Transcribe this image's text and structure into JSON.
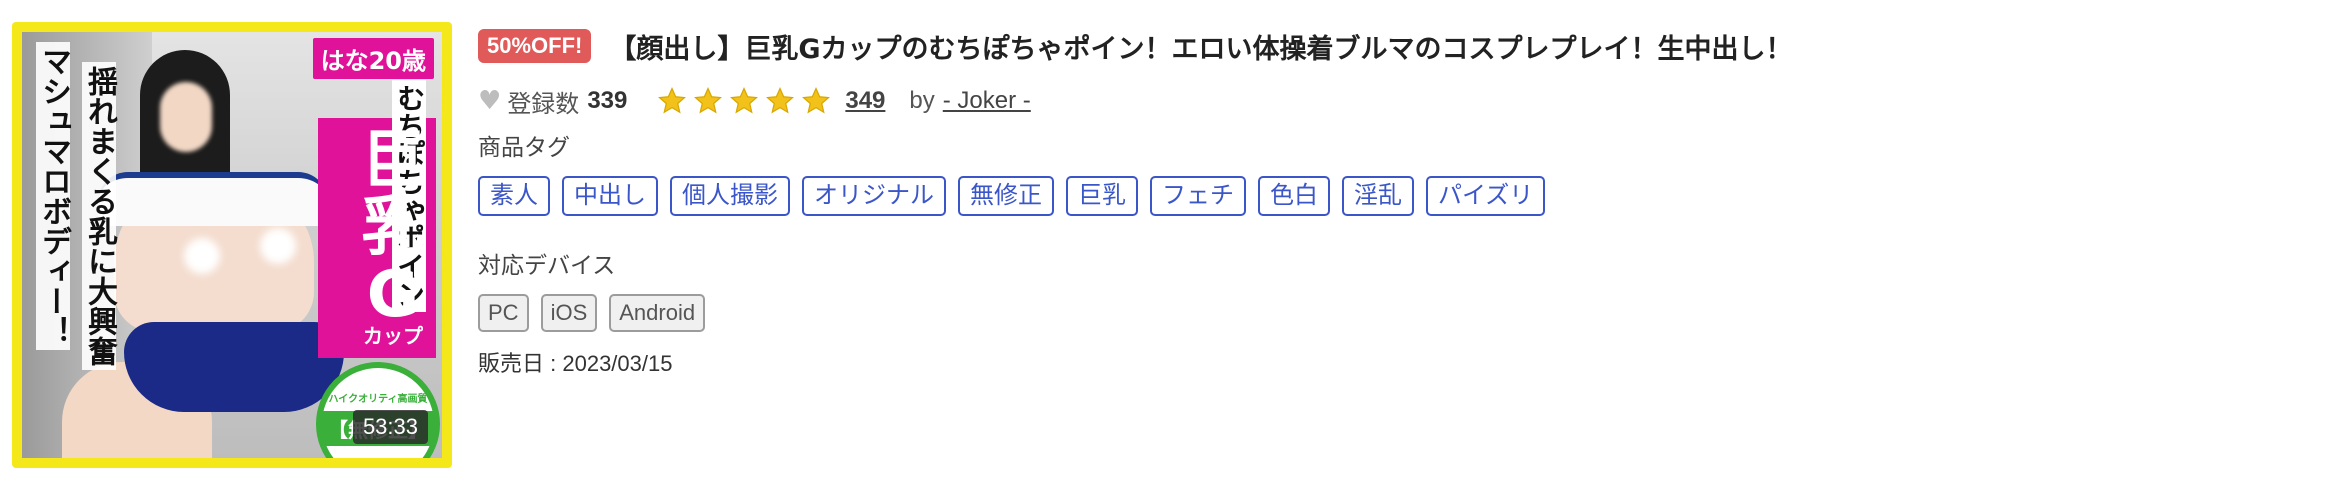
{
  "thumbnail": {
    "duration": "53:33",
    "age_badge": "はな20歳",
    "catch_copy_1": "マシュマロボディー！",
    "catch_copy_2": "揺れまくる乳に大興奮",
    "catch_copy_3": "むちぽちゃポイン",
    "big_title": "巨乳G",
    "cup_label": "カップ",
    "quality_small": "ハイクオリティ高画質",
    "quality_main": "【無修正】",
    "colors": {
      "frame": "#f5e81a",
      "panel": "#e0129a",
      "badge": "#3aaf3a"
    }
  },
  "product": {
    "discount_badge": "50%OFF!",
    "title": "【顔出し】巨乳Gカップのむちぽちゃポイン！エロい体操着ブルマのコスプレプレイ！生中出し！",
    "favorite_label": "登録数",
    "favorite_count": "339",
    "rating_stars": 5,
    "review_count": "349",
    "by_label": "by",
    "author": "- Joker -",
    "tags_heading": "商品タグ",
    "tags": [
      "素人",
      "中出し",
      "個人撮影",
      "オリジナル",
      "無修正",
      "巨乳",
      "フェチ",
      "色白",
      "淫乱",
      "パイズリ"
    ],
    "devices_heading": "対応デバイス",
    "devices": [
      "PC",
      "iOS",
      "Android"
    ],
    "release_label": "販売日",
    "release_separator": " : ",
    "release_date": "2023/03/15",
    "colors": {
      "discount": "#e05a5a",
      "tag": "#3a56c8",
      "star": "#f2c21a"
    }
  }
}
